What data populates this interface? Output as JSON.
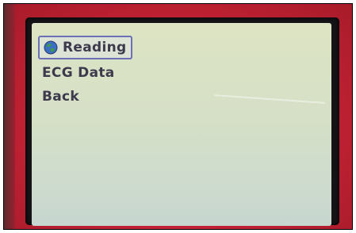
{
  "device_screen": {
    "menu": {
      "items": [
        {
          "label": "Reading",
          "icon": "globe-icon",
          "selected": true
        },
        {
          "label": "ECG Data",
          "selected": false
        },
        {
          "label": "Back",
          "selected": false
        }
      ]
    }
  },
  "colors": {
    "casing": "#c22234",
    "screen_background": "#d6e0c6",
    "menu_text": "#3c3a4c",
    "selection_border": "#6c70b4"
  }
}
